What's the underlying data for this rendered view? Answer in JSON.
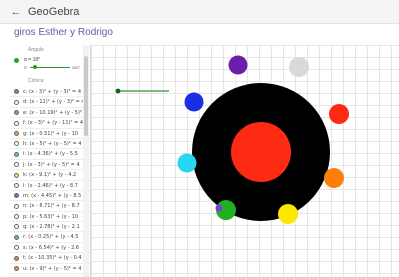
{
  "app": {
    "name": "GeoGebra",
    "back_icon": "arrow-left-icon"
  },
  "document": {
    "title": "giros Esther y Rodrigo"
  },
  "algebra": {
    "slider_category": "Ángulo",
    "slider_expr": "α = 18°",
    "slider_min": "0°",
    "slider_max": "360°",
    "circle_category": "Cónica",
    "rows": [
      {
        "color": "#888888",
        "expr": "c: (x - 3)² + (y - 3)² = 4"
      },
      {
        "color": "#ffffff",
        "expr": "d: (x - 11)² + (y - 3)² = 4"
      },
      {
        "color": "#b47fd8",
        "expr": "e: (x - 10.19)² + (y - 5)²"
      },
      {
        "color": "#ffffff",
        "expr": "f: (x - 3)² + (y - 11)² = 4"
      },
      {
        "color": "#f0a24a",
        "expr": "g: (x - 0.51)² + (y - 10"
      },
      {
        "color": "#ffffff",
        "expr": "h: (x - 5)² + (y - 5)² = 4"
      },
      {
        "color": "#3fd0e8",
        "expr": "i: (x - 4.36)² + (y - 5.5"
      },
      {
        "color": "#ffffff",
        "expr": "j: (x - 3)² + (y - 5)² = 4"
      },
      {
        "color": "#f5e742",
        "expr": "k: (x - 9.1)² + (y - 4.2"
      },
      {
        "color": "#ffffff",
        "expr": "l: (x - 2.46)² + (y - 8.7"
      },
      {
        "color": "#7a6ad0",
        "expr": "m: (x - 4.45)² + (y - 8.5"
      },
      {
        "color": "#ffffff",
        "expr": "n: (x - 8.71)² + (y - 8.7"
      },
      {
        "color": "#ffffff",
        "expr": "p: (x - 5.63)² + (y - 10"
      },
      {
        "color": "#ffffff",
        "expr": "q: (x - 2.78)² + (y - 2.1"
      },
      {
        "color": "#63c86a",
        "expr": "r: (x - 0.25)² + (y - 4.5"
      },
      {
        "color": "#ffffff",
        "expr": "s: (x - 6.54)² + (y - 2.6"
      },
      {
        "color": "#f07a50",
        "expr": "t: (x - 10.35)² + (y - 0.4"
      },
      {
        "color": "#ff8a2a",
        "expr": "u: (x - 9)² + (y - 5)² = 4"
      }
    ]
  },
  "graphics": {
    "big_circle_color": "#000000",
    "center_circle_color": "#ff2a14",
    "slider_line_color": "#2f8f2f",
    "colors": {
      "purple": "#6b1fa8",
      "light_gray": "#d9d9d9",
      "red": "#ff2a14",
      "orange": "#ff7f0e",
      "yellow": "#ffe600",
      "green": "#22b022",
      "blue_violet": "#7b3fd0",
      "cyan": "#27d7ef",
      "blue": "#1a2ee6"
    }
  }
}
